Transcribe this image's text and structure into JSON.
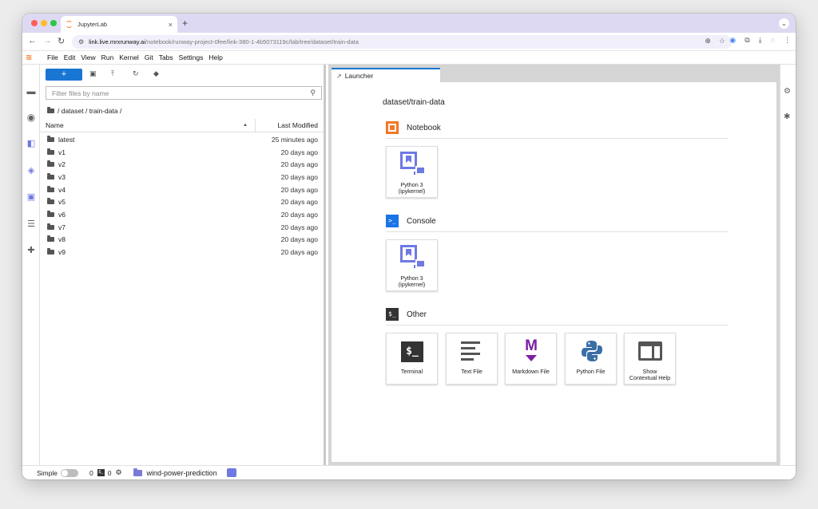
{
  "browser": {
    "tab_title": "JupyterLab",
    "tab_close": "×",
    "new_tab": "+",
    "url_host": "link.live.mrxrunway.ai",
    "url_path": "/notebook/runway-project-0fee/link-380-1-4b5073119c/lab/tree/dataset/train-data"
  },
  "menubar": {
    "items": [
      "File",
      "Edit",
      "View",
      "Run",
      "Kernel",
      "Git",
      "Tabs",
      "Settings",
      "Help"
    ]
  },
  "filebrowser": {
    "new_label": "+",
    "filter_placeholder": "Filter files by name",
    "breadcrumb": "/ dataset / train-data /",
    "header_name": "Name",
    "header_modified": "Last Modified",
    "rows": [
      {
        "name": "latest",
        "modified": "25 minutes ago"
      },
      {
        "name": "v1",
        "modified": "20 days ago"
      },
      {
        "name": "v2",
        "modified": "20 days ago"
      },
      {
        "name": "v3",
        "modified": "20 days ago"
      },
      {
        "name": "v4",
        "modified": "20 days ago"
      },
      {
        "name": "v5",
        "modified": "20 days ago"
      },
      {
        "name": "v6",
        "modified": "20 days ago"
      },
      {
        "name": "v7",
        "modified": "20 days ago"
      },
      {
        "name": "v8",
        "modified": "20 days ago"
      },
      {
        "name": "v9",
        "modified": "20 days ago"
      }
    ]
  },
  "main": {
    "tab_label": "Launcher",
    "launcher": {
      "path": "dataset/train-data",
      "notebook_title": "Notebook",
      "console_title": "Console",
      "other_title": "Other",
      "notebook_card": {
        "line1": "Python 3",
        "line2": "(ipykernel)"
      },
      "console_card": {
        "line1": "Python 3",
        "line2": "(ipykernel)"
      },
      "console_glyph": ">_",
      "other_glyph": "$_",
      "terminal_glyph": "$_",
      "markdown_glyph": "M",
      "other_cards": {
        "terminal": "Terminal",
        "text_file": "Text File",
        "markdown_file": "Markdown File",
        "python_file": "Python File",
        "help_line1": "Show",
        "help_line2": "Contextual Help"
      }
    }
  },
  "statusbar": {
    "simple_label": "Simple",
    "terminals_count": "0",
    "kernels_count": "0",
    "terminal_glyph": "$_",
    "project": "wind-power-prediction"
  },
  "colors": {
    "accent": "#1976d2",
    "jupyter_orange": "#f37726",
    "kernel_purple": "#6f79e3",
    "markdown_purple": "#7b1fa2",
    "tabbar": "#ded9f2"
  },
  "icons": {
    "left_sidebar": [
      "folder-icon",
      "running-icon",
      "git-icon",
      "extension-layers-icon",
      "runway-icon",
      "toc-icon",
      "puzzle-icon"
    ],
    "right_sidebar": [
      "property-inspector-icon",
      "debugger-icon"
    ],
    "file_toolbar": [
      "new-folder-icon",
      "upload-icon",
      "refresh-icon",
      "git-clone-icon"
    ]
  }
}
